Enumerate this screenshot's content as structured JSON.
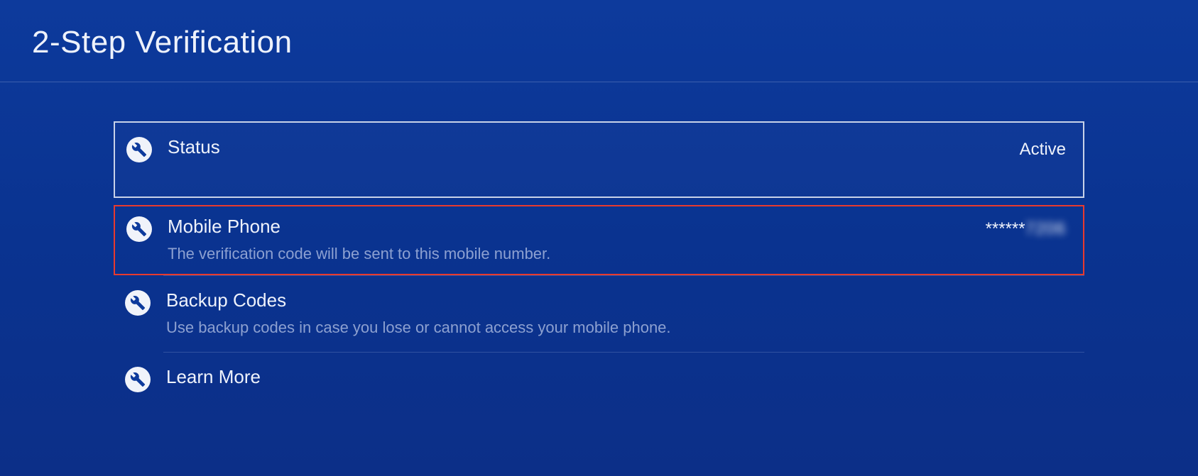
{
  "header": {
    "title": "2-Step Verification"
  },
  "icons": {
    "wrench": "wrench-icon"
  },
  "items": {
    "status": {
      "label": "Status",
      "value": "Active"
    },
    "mobile": {
      "label": "Mobile Phone",
      "desc": "The verification code will be sent to this mobile number.",
      "value_mask": "******",
      "value_blurred": "7206"
    },
    "backup": {
      "label": "Backup Codes",
      "desc": "Use backup codes in case you lose or cannot access your mobile phone."
    },
    "learn": {
      "label": "Learn More"
    }
  }
}
